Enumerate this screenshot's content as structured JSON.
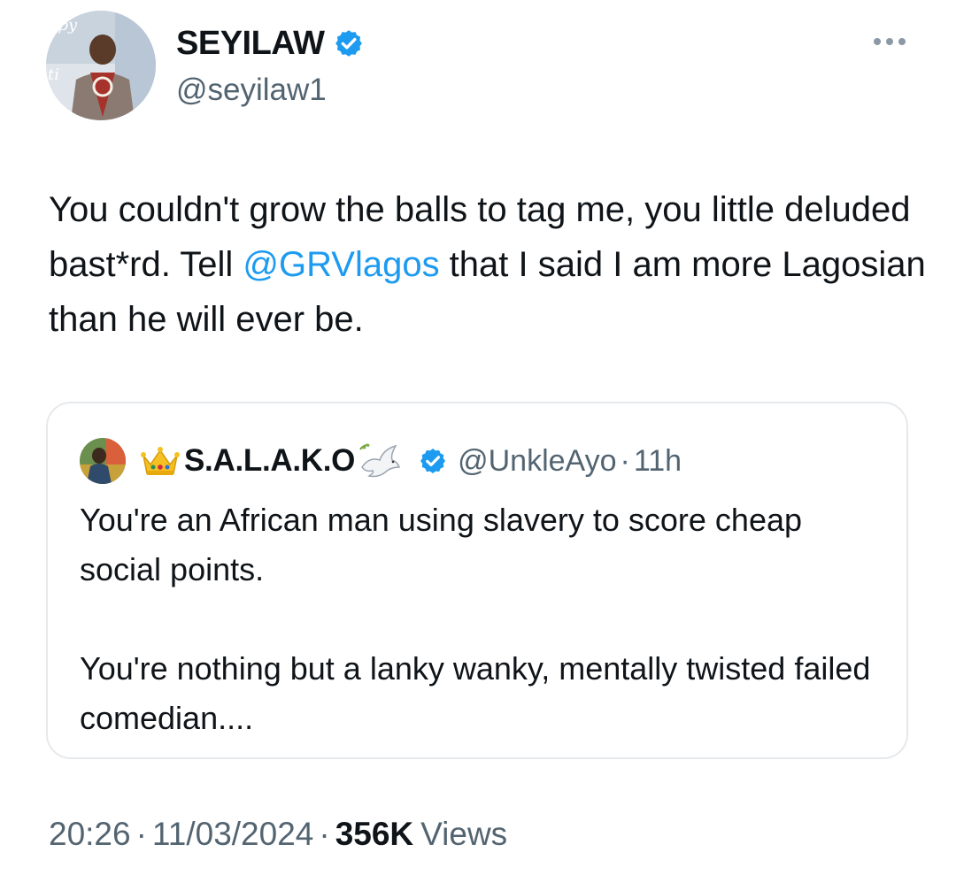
{
  "author": {
    "display_name": "SEYILAW",
    "handle": "@seyilaw1",
    "verified": true
  },
  "tweet": {
    "text_before": "You couldn't grow the balls to tag me, you little deluded bast*rd. Tell ",
    "mention": "@GRVlagos",
    "text_after": " that I said I am more Lagosian than he will ever be."
  },
  "quoted_tweet": {
    "display_name": "S.A.L.A.K.O",
    "handle": "@UnkleAyo",
    "separator": "·",
    "time": "11h",
    "verified": true,
    "paragraphs": [
      "You're an African man using slavery to score cheap social points.",
      "You're nothing but a lanky wanky, mentally twisted failed comedian...."
    ]
  },
  "meta": {
    "time": "20:26",
    "separator": "·",
    "date": "11/03/2024",
    "views_count": "356K",
    "views_label": "Views"
  },
  "colors": {
    "accent": "#1d9bf0",
    "text_primary": "#0f1419",
    "text_secondary": "#536471",
    "border": "#e6e9ec"
  },
  "icons": {
    "verified": "verified-badge-icon",
    "more": "more-options-icon",
    "crown": "crown-emoji-icon",
    "dove": "dove-emoji-icon"
  }
}
